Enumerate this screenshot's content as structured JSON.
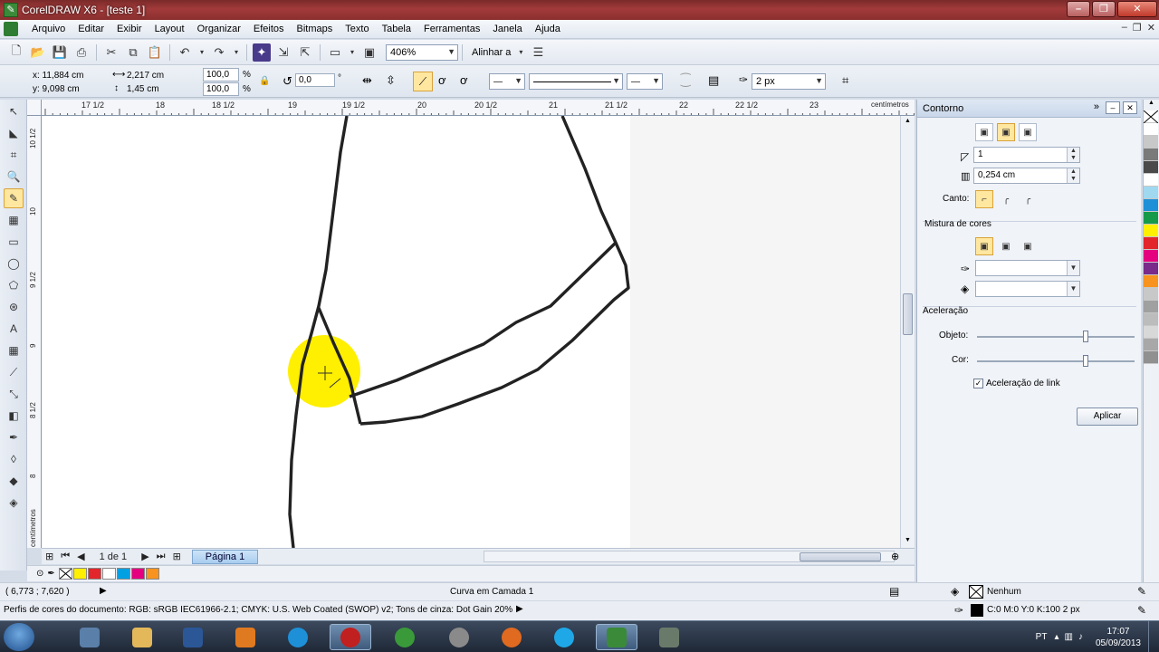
{
  "window": {
    "title": "CorelDRAW X6 - [teste 1]"
  },
  "menu": {
    "items": [
      "Arquivo",
      "Editar",
      "Exibir",
      "Layout",
      "Organizar",
      "Efeitos",
      "Bitmaps",
      "Texto",
      "Tabela",
      "Ferramentas",
      "Janela",
      "Ajuda"
    ]
  },
  "toolbar": {
    "zoom": "406%",
    "align_label": "Alinhar a"
  },
  "properties": {
    "x": "x: 11,884 cm",
    "y": "y: 9,098 cm",
    "w": "2,217 cm",
    "h": "1,45 cm",
    "scale_w": "100,0",
    "scale_h": "100,0",
    "pct": "%",
    "angle": "0,0",
    "deg": "°",
    "outline_width": "2 px"
  },
  "ruler": {
    "top_labels": [
      "17 1/2",
      "18",
      "18 1/2",
      "19",
      "19 1/2",
      "20",
      "20 1/2",
      "21",
      "21 1/2",
      "22",
      "22 1/2",
      "23"
    ],
    "unit": "centímetros",
    "left_labels": [
      "10 1/2",
      "10",
      "9 1/2",
      "9",
      "8 1/2",
      "8"
    ],
    "left_unit": "centímetros"
  },
  "pagenav": {
    "counter": "1 de 1",
    "page_tab": "Página 1"
  },
  "statusbar": {
    "coords": "( 6,773 ; 7,620 )",
    "object_info": "Curva em Camada 1",
    "color_profiles": "Perfis de cores do documento: RGB: sRGB IEC61966-2.1; CMYK: U.S. Web Coated (SWOP) v2; Tons de cinza: Dot Gain 20%",
    "fill": "Nenhum",
    "outline": "C:0 M:0 Y:0 K:100  2 px"
  },
  "docker": {
    "title": "Contorno",
    "steps": "1",
    "offset": "0,254 cm",
    "corner_label": "Canto:",
    "blend_label": "Mistura de cores",
    "accel_label": "Aceleração",
    "object_label": "Objeto:",
    "color_label": "Cor:",
    "link_accel_label": "Aceleração de link",
    "link_accel_checked": true,
    "object_accel": 0.69,
    "color_accel": 0.69,
    "apply_label": "Aplicar"
  },
  "doc_palette": [
    "#ffef00",
    "#e3262c",
    "#ffffff",
    "#00a0e3",
    "#e4007f",
    "#f7931e"
  ],
  "color_palette": [
    "#ffffff",
    "#c8c8c8",
    "#7a7a7a",
    "#4a4a4a",
    "#ffffff",
    "#a0d8f0",
    "#1e90d8",
    "#159a4a",
    "#ffef00",
    "#e3262c",
    "#e4007f",
    "#7a2a8a",
    "#f7931e",
    "#c8c8c8",
    "#a0a0a0",
    "#bcbcbc",
    "#d8d8d8",
    "#a8a8a8",
    "#909090"
  ],
  "highlight_color": "#ffef00",
  "taskbar": {
    "language": "PT",
    "time": "17:07",
    "date": "05/09/2013",
    "apps": [
      "explorer-icon",
      "files-icon",
      "word-icon",
      "media-icon",
      "ie-icon",
      "opera-icon",
      "chrome-icon",
      "timer-icon",
      "firefox-icon",
      "skype-icon",
      "coreldraw-icon",
      "corel-capture-icon"
    ]
  }
}
